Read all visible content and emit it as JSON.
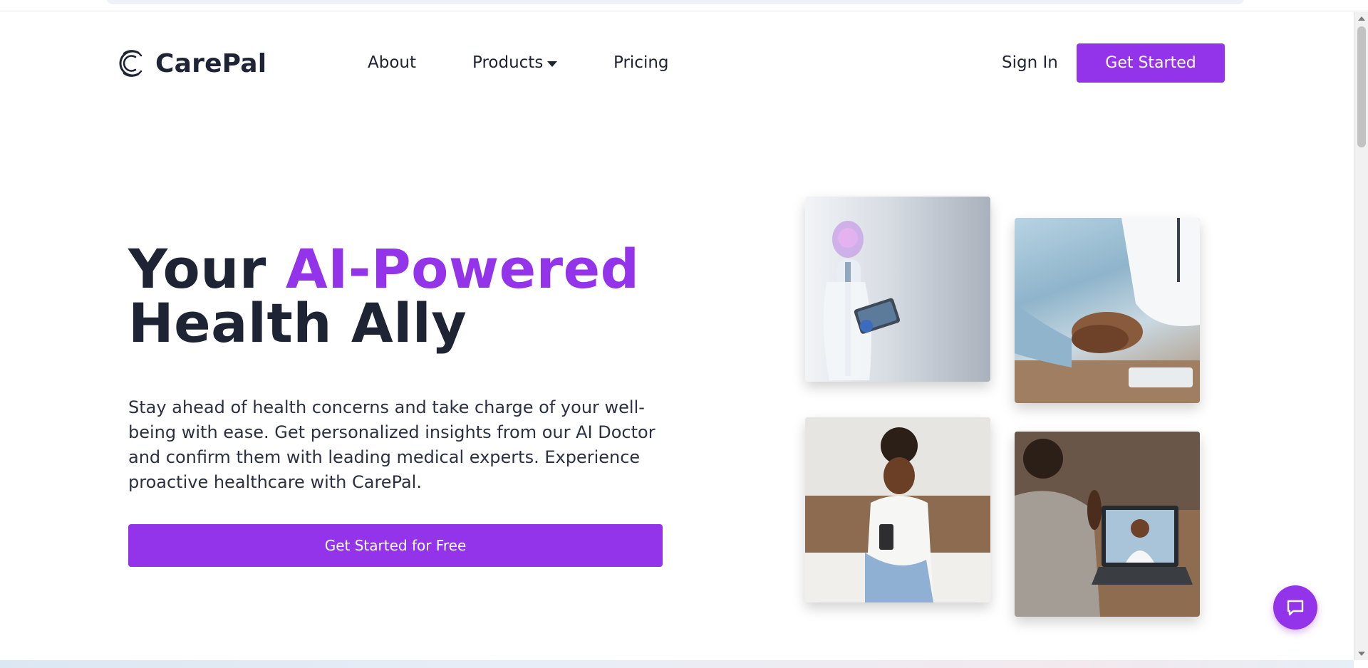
{
  "brand": {
    "name": "CarePal",
    "accent_color": "#9333ea",
    "text_color": "#1e2433"
  },
  "nav": {
    "about": "About",
    "products": "Products",
    "pricing": "Pricing",
    "sign_in": "Sign In",
    "get_started": "Get Started"
  },
  "hero": {
    "title_prefix": "Your ",
    "title_accent": "AI-Powered",
    "title_line2": "Health Ally",
    "description": "Stay ahead of health concerns and take charge of your well-being with ease. Get personalized insights from our AI Doctor and confirm them with leading medical experts. Experience proactive healthcare with CarePal.",
    "cta": "Get Started for Free"
  },
  "images": [
    {
      "name": "ai-doctor-robot-image"
    },
    {
      "name": "holding-hands-image"
    },
    {
      "name": "woman-with-phone-image"
    },
    {
      "name": "video-call-doctor-image"
    }
  ],
  "icons": {
    "logo": "carepal-logo-icon",
    "caret": "chevron-down-icon",
    "chat": "chat-icon"
  }
}
